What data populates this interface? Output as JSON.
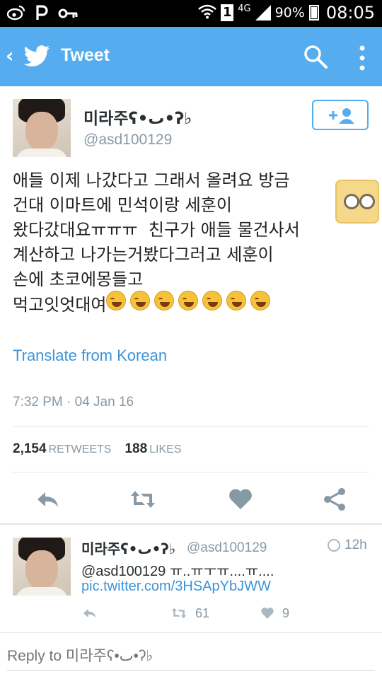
{
  "status_bar": {
    "icons": [
      "weibo-icon",
      "p-icon",
      "key-icon",
      "wifi-icon",
      "sim-icon",
      "signal-icon",
      "battery-icon"
    ],
    "sim_slot": "1",
    "network": "4G",
    "battery": "90%",
    "time": "08:05"
  },
  "toolbar": {
    "title": "Tweet",
    "accent_color": "#55acee"
  },
  "tweet": {
    "display_name": "미라주ʕ•ٮ•ʔ♭",
    "handle": "@asd100129",
    "body": "애들 이제 나갔다고 그래서 올려요 방금\n건대 이마트에 민석이랑 세훈이\n왔다갔대요ㅠㅠㅠ  친구가 애들 물건사서\n계산하고 나가는거봤다그러고 세훈이\n손에 초코에몽들고\n먹고잇엇대여",
    "emoji_count": 7,
    "translate": "Translate from Korean",
    "timestamp": "7:32 PM · 04 Jan 16",
    "retweets_count": "2,154",
    "retweets_label": "RETWEETS",
    "likes_count": "188",
    "likes_label": "LIKES"
  },
  "reply_tweet": {
    "display_name": "미라주ʕ•ٮ•ʔ♭",
    "handle": "@asd100129",
    "time": "12h",
    "text": "@asd100129 ㅠ..ㅠㅜㅠ....ㅠ....",
    "link": "pic.twitter.com/3HSApYbJWW",
    "retweets": "61",
    "likes": "9"
  },
  "composer": {
    "placeholder": "Reply to 미라주ʕ•ٮ•ʔ♭"
  }
}
